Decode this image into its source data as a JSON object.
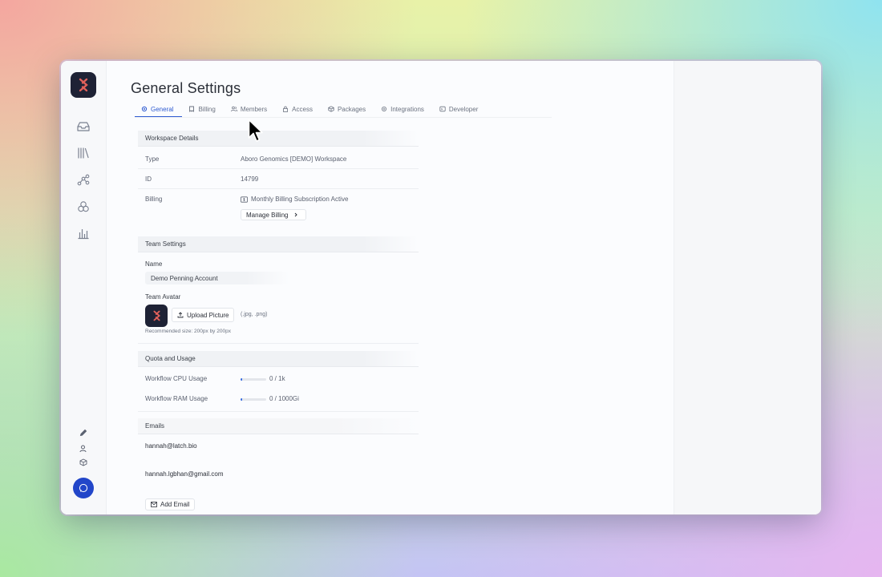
{
  "page": {
    "title": "General Settings"
  },
  "tabs": [
    {
      "label": "General",
      "icon": "gear-icon",
      "active": true
    },
    {
      "label": "Billing",
      "icon": "receipt-icon"
    },
    {
      "label": "Members",
      "icon": "users-icon"
    },
    {
      "label": "Access",
      "icon": "lock-icon"
    },
    {
      "label": "Packages",
      "icon": "package-icon"
    },
    {
      "label": "Integrations",
      "icon": "plug-icon"
    },
    {
      "label": "Developer",
      "icon": "code-icon"
    }
  ],
  "workspace": {
    "header": "Workspace Details",
    "type_label": "Type",
    "type_value": "Aboro Genomics [DEMO] Workspace",
    "id_label": "ID",
    "id_value": "14799",
    "billing_label": "Billing",
    "billing_status": "Monthly Billing Subscription Active",
    "manage_billing": "Manage Billing"
  },
  "team": {
    "header": "Team Settings",
    "name_label": "Name",
    "name_value": "Demo Penning Account",
    "avatar_label": "Team Avatar",
    "upload_label": "Upload Picture",
    "upload_formats": "(.jpg, .png)",
    "recommended": "Recommended size: 200px by 200px"
  },
  "quota": {
    "header": "Quota and Usage",
    "cpu_label": "Workflow CPU Usage",
    "cpu_value": "0 / 1k",
    "cpu_fraction": 0.05,
    "ram_label": "Workflow RAM Usage",
    "ram_value": "0 / 1000Gi",
    "ram_fraction": 0.05
  },
  "emails": {
    "header": "Emails",
    "list": [
      "hannah@latch.bio",
      "hannah.lgbhan@gmail.com"
    ],
    "add_label": "Add Email"
  },
  "colors": {
    "accent": "#2f5bd1",
    "chat": "#2246c9",
    "logo_bg": "#1e2235",
    "logo_mark": "#e0605a"
  }
}
